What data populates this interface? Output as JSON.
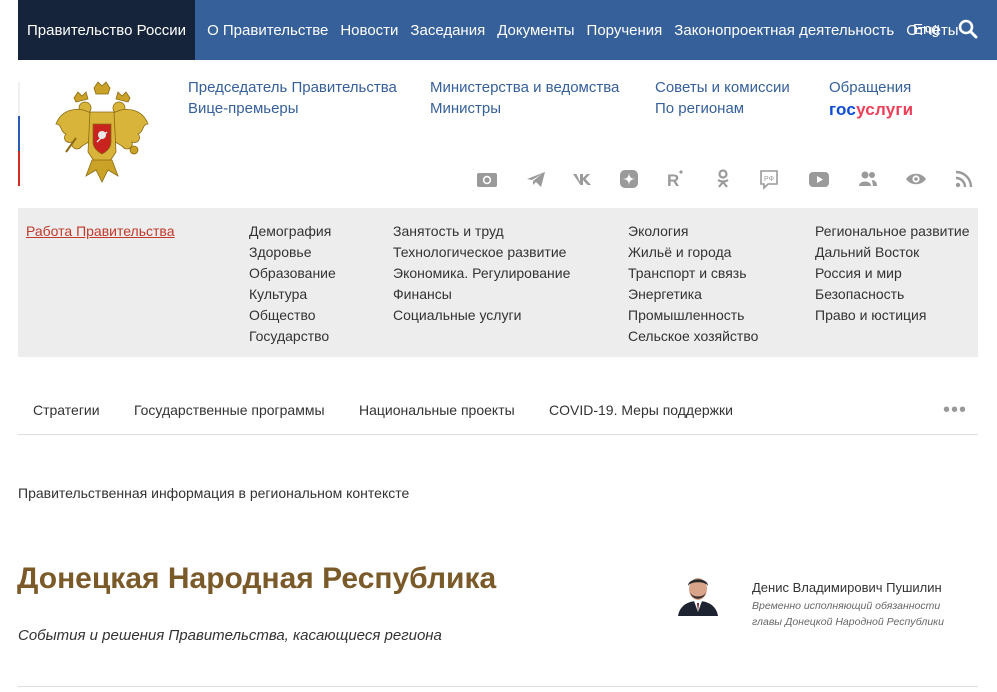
{
  "topnav": {
    "brand": "Правительство России",
    "items": [
      "О Правительстве",
      "Новости",
      "Заседания",
      "Документы",
      "Поручения",
      "Законопроектная деятельность",
      "Отчёты"
    ],
    "lang": "Eng"
  },
  "header": {
    "links": {
      "chairman": "Председатель Правительства",
      "vice": "Вице-премьеры",
      "ministries": "Министерства и ведомства",
      "ministers": "Министры",
      "councils": "Советы и комиссии",
      "regions": "По регионам",
      "appeals": "Обращения"
    },
    "gosuslugi": {
      "part1": "гос",
      "part2": "услуги"
    },
    "social_icons": [
      "camera-icon",
      "telegram-icon",
      "vk-icon",
      "yandex-zen-icon",
      "rutube-icon",
      "odnoklassniki-icon",
      "rf-chat-icon",
      "youtube-icon",
      "users-icon",
      "eye-icon",
      "rss-icon"
    ]
  },
  "topics": {
    "work_label": "Работа Правительства",
    "col1": [
      "Демография",
      "Здоровье",
      "Образование",
      "Культура",
      "Общество",
      "Государство"
    ],
    "col2": [
      "Занятость и труд",
      "Технологическое развитие",
      "Экономика. Регулирование",
      "Финансы",
      "Социальные услуги"
    ],
    "col3": [
      "Экология",
      "Жильё и города",
      "Транспорт и связь",
      "Энергетика",
      "Промышленность",
      "Сельское хозяйство"
    ],
    "col4": [
      "Региональное развитие",
      "Дальний Восток",
      "Россия и мир",
      "Безопасность",
      "Право и юстиция"
    ]
  },
  "subnav": {
    "items": [
      "Стратегии",
      "Государственные программы",
      "Национальные проекты",
      "COVID-19. Меры поддержки"
    ],
    "more": "•••"
  },
  "main": {
    "context": "Правительственная информация в региональном контексте",
    "title": "Донецкая Народная Республика",
    "subtitle": "События и решения Правительства, касающиеся региона",
    "person_name": "Денис Владимирович Пушилин",
    "person_role": "Временно исполняющий обязанности главы Донецкой Народной Республики"
  },
  "colors": {
    "topbar": "#36609a",
    "brand_bg": "#15243a",
    "title": "#7b5a2a",
    "link": "#36609a"
  }
}
